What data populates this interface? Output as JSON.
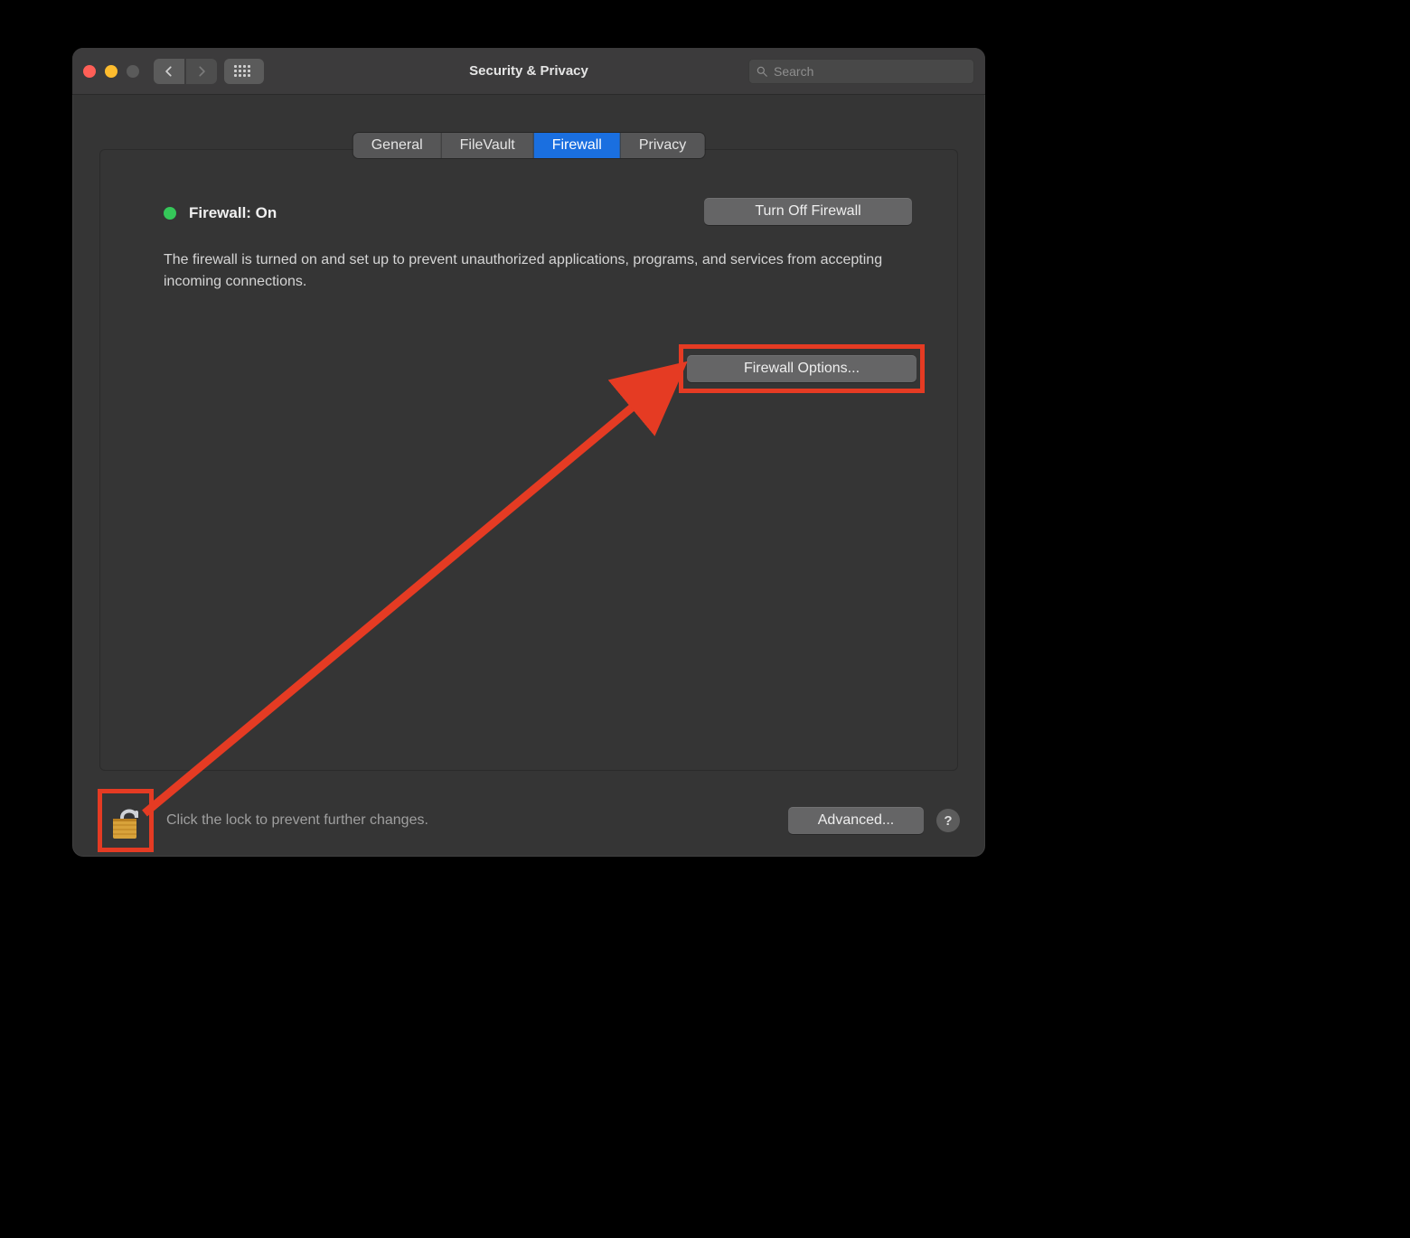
{
  "window": {
    "title": "Security & Privacy"
  },
  "search": {
    "placeholder": "Search"
  },
  "tabs": {
    "general": "General",
    "filevault": "FileVault",
    "firewall": "Firewall",
    "privacy": "Privacy",
    "active": "firewall"
  },
  "firewall": {
    "status_label": "Firewall: On",
    "status_color": "#35c759",
    "turn_off_label": "Turn Off Firewall",
    "description": "The firewall is turned on and set up to prevent unauthorized applications, programs, and services from accepting incoming connections.",
    "options_label": "Firewall Options..."
  },
  "footer": {
    "lock_text": "Click the lock to prevent further changes.",
    "advanced_label": "Advanced...",
    "help_label": "?"
  },
  "annotation": {
    "highlight_color": "#e53b23"
  }
}
